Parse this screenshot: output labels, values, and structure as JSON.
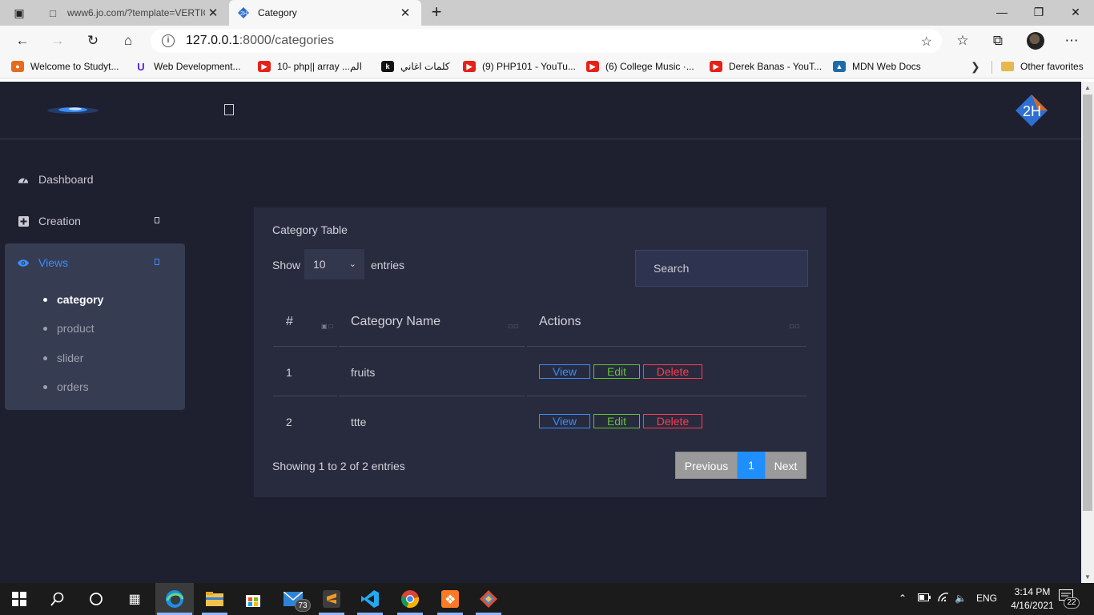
{
  "browser": {
    "tabs": [
      {
        "title": "www6.jo.com/?template=VERTIC",
        "active": false
      },
      {
        "title": "Category",
        "active": true
      }
    ],
    "url_host": "127.0.0.1",
    "url_path": ":8000/categories",
    "favorites": [
      {
        "label": "Welcome to Studyt...",
        "icon": "studytonight-icon",
        "color": "#e86a1c"
      },
      {
        "label": "Web Development...",
        "icon": "udemy-icon",
        "color": "#5624d0"
      },
      {
        "label": "10- php|| array ...الم",
        "icon": "youtube-icon",
        "color": "#e62117"
      },
      {
        "label": "كلمات اغاني",
        "icon": "k-icon",
        "color": "#111111"
      },
      {
        "label": "(9) PHP101 - YouTu...",
        "icon": "youtube-icon",
        "color": "#e62117"
      },
      {
        "label": "(6) College Music ·...",
        "icon": "youtube-icon",
        "color": "#e62117"
      },
      {
        "label": "Derek Banas - YouT...",
        "icon": "youtube-icon",
        "color": "#e62117"
      },
      {
        "label": "MDN Web Docs",
        "icon": "mdn-icon",
        "color": "#1b6ca8"
      },
      {
        "label": "Other favorites",
        "icon": "folder-icon",
        "color": "#e6b94d"
      }
    ]
  },
  "sidebar": {
    "items": [
      {
        "label": "Dashboard",
        "icon": "dashboard-icon"
      },
      {
        "label": "Creation",
        "icon": "plus-square-icon"
      },
      {
        "label": "Views",
        "icon": "eye-icon"
      }
    ],
    "views_sub": [
      {
        "label": "category",
        "active": true
      },
      {
        "label": "product",
        "active": false
      },
      {
        "label": "slider",
        "active": false
      },
      {
        "label": "orders",
        "active": false
      }
    ]
  },
  "table": {
    "title": "Category Table",
    "show_label": "Show",
    "entries_label": "entries",
    "page_length": "10",
    "search_placeholder": "Search",
    "columns": [
      "#",
      "Category Name",
      "Actions"
    ],
    "rows": [
      {
        "id": "1",
        "name": "fruits"
      },
      {
        "id": "2",
        "name": "ttte"
      }
    ],
    "actions": {
      "view": "View",
      "edit": "Edit",
      "delete": "Delete"
    },
    "info": "Showing 1 to 2 of 2 entries",
    "pagination": {
      "previous": "Previous",
      "current": "1",
      "next": "Next"
    }
  },
  "taskbar": {
    "mail_badge": "73",
    "lang": "ENG",
    "time": "3:14 PM",
    "date": "4/16/2021",
    "notifications": "22"
  },
  "colors": {
    "page_bg": "#1e1f2f",
    "card_bg": "#282b3e",
    "accent_blue": "#1f8fff",
    "view_blue": "#3a8dff",
    "edit_green": "#5fc23a",
    "delete_red": "#ff3b52"
  }
}
